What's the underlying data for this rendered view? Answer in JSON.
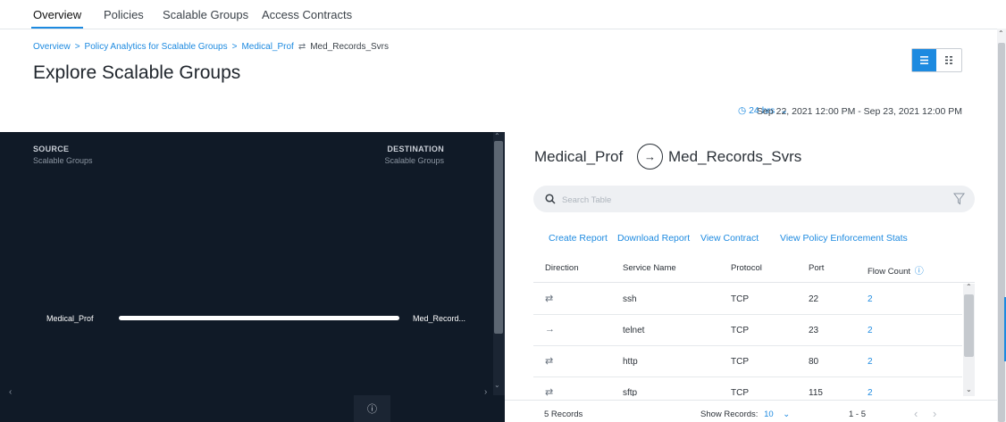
{
  "tabs": [
    {
      "label": "Overview",
      "active": true
    },
    {
      "label": "Policies",
      "active": false
    },
    {
      "label": "Scalable Groups",
      "active": false
    },
    {
      "label": "Access Contracts",
      "active": false
    }
  ],
  "breadcrumb": {
    "items": [
      "Overview",
      "Policy Analytics for Scalable Groups",
      "Medical_Prof"
    ],
    "current": "Med_Records_Svrs"
  },
  "page_title": "Explore Scalable Groups",
  "view_toggle": {
    "active": "list"
  },
  "time_range": {
    "label": "24 hrs",
    "dates": "Sep 22, 2021 12:00 PM - Sep 23, 2021 12:00 PM"
  },
  "left_panel": {
    "source_heading": "SOURCE",
    "source_sub": "Scalable Groups",
    "destination_heading": "DESTINATION",
    "destination_sub": "Scalable Groups",
    "source_node": "Medical_Prof",
    "destination_node": "Med_Record..."
  },
  "right_panel": {
    "source": "Medical_Prof",
    "destination": "Med_Records_Svrs",
    "search_placeholder": "Search Table",
    "actions": [
      "Create Report",
      "Download Report",
      "View Contract",
      "View Policy Enforcement Stats"
    ],
    "columns": [
      "Direction",
      "Service Name",
      "Protocol",
      "Port",
      "Flow Count"
    ],
    "rows": [
      {
        "direction": "bidirectional",
        "service": "ssh",
        "protocol": "TCP",
        "port": "22",
        "flow_count": "2"
      },
      {
        "direction": "unidirectional",
        "service": "telnet",
        "protocol": "TCP",
        "port": "23",
        "flow_count": "2"
      },
      {
        "direction": "bidirectional",
        "service": "http",
        "protocol": "TCP",
        "port": "80",
        "flow_count": "2"
      },
      {
        "direction": "bidirectional",
        "service": "sftp",
        "protocol": "TCP",
        "port": "115",
        "flow_count": "2"
      }
    ],
    "footer": {
      "record_count": "5 Records",
      "show_records_label": "Show Records:",
      "show_records_value": "10",
      "page_range": "1 - 5"
    }
  },
  "colors": {
    "accent": "#1d8ae0",
    "dark_panel": "#101a27"
  }
}
